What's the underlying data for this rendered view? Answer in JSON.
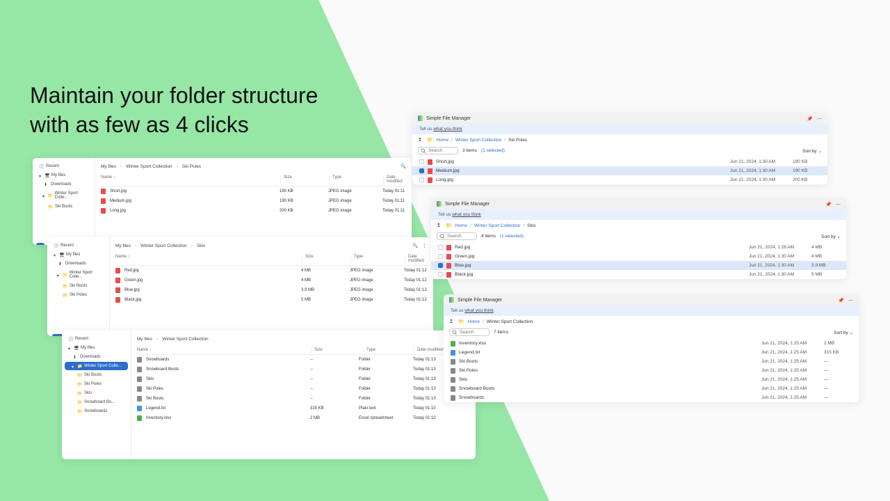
{
  "headline_l1": "Maintain your folder structure",
  "headline_l2": "with as few as 4 clicks",
  "os": {
    "recent": "Recent",
    "myfiles": "My files",
    "downloads": "Downloads",
    "wsc": "Winter Sport Colle...",
    "skiboots": "Ski Boots",
    "skis": "Skis",
    "skipoles": "Ski Poles",
    "snowboardb": "Snowboard Bo...",
    "snowboards": "Snowboards",
    "bc_myfiles": "My files",
    "bc_wsc": "Winter Sport Collection",
    "bc_skipoles": "Ski Poles",
    "bc_skis": "Skis",
    "hdr_name": "Name",
    "hdr_size": "Size",
    "hdr_type": "Type",
    "hdr_date": "Date modified",
    "p1": {
      "rows": [
        {
          "name": "Short.jpg",
          "size": "190 KB",
          "type": "JPEG image",
          "date": "Today 01:11"
        },
        {
          "name": "Medium.jpg",
          "size": "190 KB",
          "type": "JPEG image",
          "date": "Today 01:11"
        },
        {
          "name": "Long.jpg",
          "size": "200 KB",
          "type": "JPEG image",
          "date": "Today 01:11"
        }
      ]
    },
    "p2": {
      "rows": [
        {
          "name": "Red.jpg",
          "size": "4 MB",
          "type": "JPEG image",
          "date": "Today 01:12"
        },
        {
          "name": "Green.jpg",
          "size": "4 MB",
          "type": "JPEG image",
          "date": "Today 01:12"
        },
        {
          "name": "Blue.jpg",
          "size": "3.9 MB",
          "type": "JPEG image",
          "date": "Today 01:12"
        },
        {
          "name": "Black.jpg",
          "size": "5 MB",
          "type": "JPEG image",
          "date": "Today 01:12"
        }
      ]
    },
    "p3": {
      "rows": [
        {
          "name": "Snowboards",
          "size": "--",
          "type": "Folder",
          "date": "Today 01:13"
        },
        {
          "name": "Snowboard Boots",
          "size": "--",
          "type": "Folder",
          "date": "Today 01:13"
        },
        {
          "name": "Skis",
          "size": "--",
          "type": "Folder",
          "date": "Today 01:13"
        },
        {
          "name": "Ski Poles",
          "size": "--",
          "type": "Folder",
          "date": "Today 01:13"
        },
        {
          "name": "Ski Boots",
          "size": "--",
          "type": "Folder",
          "date": "Today 01:13"
        },
        {
          "name": "Legend.txt",
          "size": "315 KB",
          "type": "Plain text",
          "date": "Today 01:10"
        },
        {
          "name": "Inventory.xlsx",
          "size": "2 MB",
          "type": "Excel spreadsheet",
          "date": "Today 01:10"
        }
      ]
    }
  },
  "sfm": {
    "title": "Simple File Manager",
    "feedback_pre": "Tell us ",
    "feedback_link": "what you think",
    "home": "Home",
    "wsc": "Winter Sport Collection",
    "skipoles": "Ski Poles",
    "skis": "Skis",
    "search_ph": "Search",
    "sortby": "Sort by",
    "p1": {
      "count": "3 items",
      "selected": "(1 selected)",
      "rows": [
        {
          "name": "Short.jpg",
          "date": "Jun 21, 2024, 1:30 AM",
          "size": "190 KB",
          "sel": false,
          "fico": "fico-img"
        },
        {
          "name": "Medium.jpg",
          "date": "Jun 21, 2024, 1:30 AM",
          "size": "190 KB",
          "sel": true,
          "fico": "fico-img"
        },
        {
          "name": "Long.jpg",
          "date": "Jun 21, 2024, 1:30 AM",
          "size": "200 KB",
          "sel": false,
          "fico": "fico-img"
        }
      ]
    },
    "p2": {
      "count": "4 items",
      "selected": "(1 selected)",
      "rows": [
        {
          "name": "Red.jpg",
          "date": "Jun 21, 2024, 1:28 AM",
          "size": "4 MB",
          "sel": false,
          "fico": "fico-img"
        },
        {
          "name": "Green.jpg",
          "date": "Jun 21, 2024, 1:30 AM",
          "size": "4 MB",
          "sel": false,
          "fico": "fico-img"
        },
        {
          "name": "Blue.jpg",
          "date": "Jun 21, 2024, 1:30 AM",
          "size": "3.9 MB",
          "sel": true,
          "fico": "fico-img"
        },
        {
          "name": "Black.jpg",
          "date": "Jun 21, 2024, 1:30 AM",
          "size": "5 MB",
          "sel": false,
          "fico": "fico-img"
        }
      ]
    },
    "p3": {
      "count": "7 items",
      "rows": [
        {
          "name": "Inventory.xlsx",
          "date": "Jun 21, 2024, 1:25 AM",
          "size": "2 MB",
          "fico": "fico-xls"
        },
        {
          "name": "Legend.txt",
          "date": "Jun 21, 2024, 1:25 AM",
          "size": "315 KB",
          "fico": "fico-txt"
        },
        {
          "name": "Ski Boots",
          "date": "Jun 21, 2024, 1:25 AM",
          "size": "—",
          "fico": "fico-folder"
        },
        {
          "name": "Ski Poles",
          "date": "Jun 21, 2024, 1:25 AM",
          "size": "—",
          "fico": "fico-folder"
        },
        {
          "name": "Skis",
          "date": "Jun 21, 2024, 1:25 AM",
          "size": "—",
          "fico": "fico-folder"
        },
        {
          "name": "Snowboard Boots",
          "date": "Jun 21, 2024, 1:25 AM",
          "size": "—",
          "fico": "fico-folder"
        },
        {
          "name": "Snowboards",
          "date": "Jun 21, 2024, 1:25 AM",
          "size": "—",
          "fico": "fico-folder"
        }
      ]
    }
  }
}
